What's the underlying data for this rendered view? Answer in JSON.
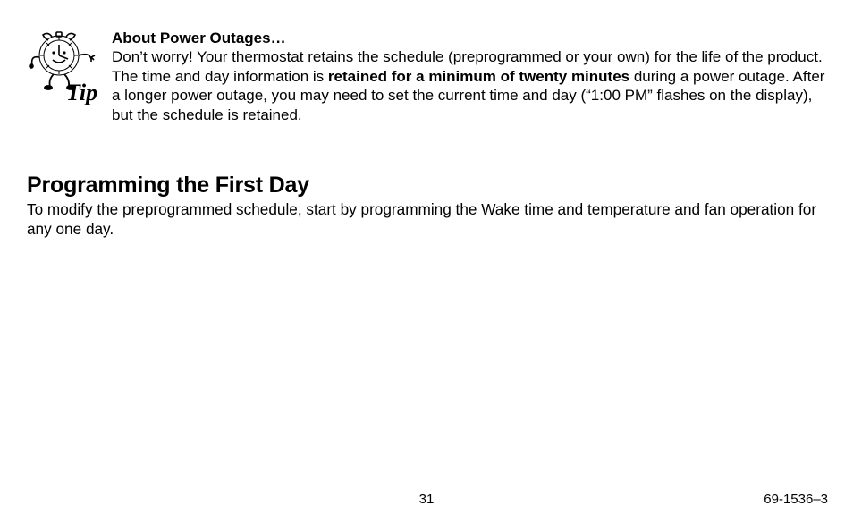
{
  "tip": {
    "title": "About Power Outages…",
    "p1a": "Don’t worry! Your thermostat retains the schedule (preprogrammed or your own) for the life of the product. The time and day information is ",
    "p1bold": "retained for a minimum of twenty minutes",
    "p1b": " during a power outage. After a longer power outage, you may need to set the current time and day (“1:00 PM” flashes on the display), but the schedule is retained.",
    "icon_label": "Tip"
  },
  "section": {
    "heading": "Programming the First Day",
    "body": "To modify the preprogrammed schedule, start by programming the Wake time and temperature and fan operation for any one day."
  },
  "footer": {
    "page": "31",
    "docnum": "69-1536–3"
  }
}
